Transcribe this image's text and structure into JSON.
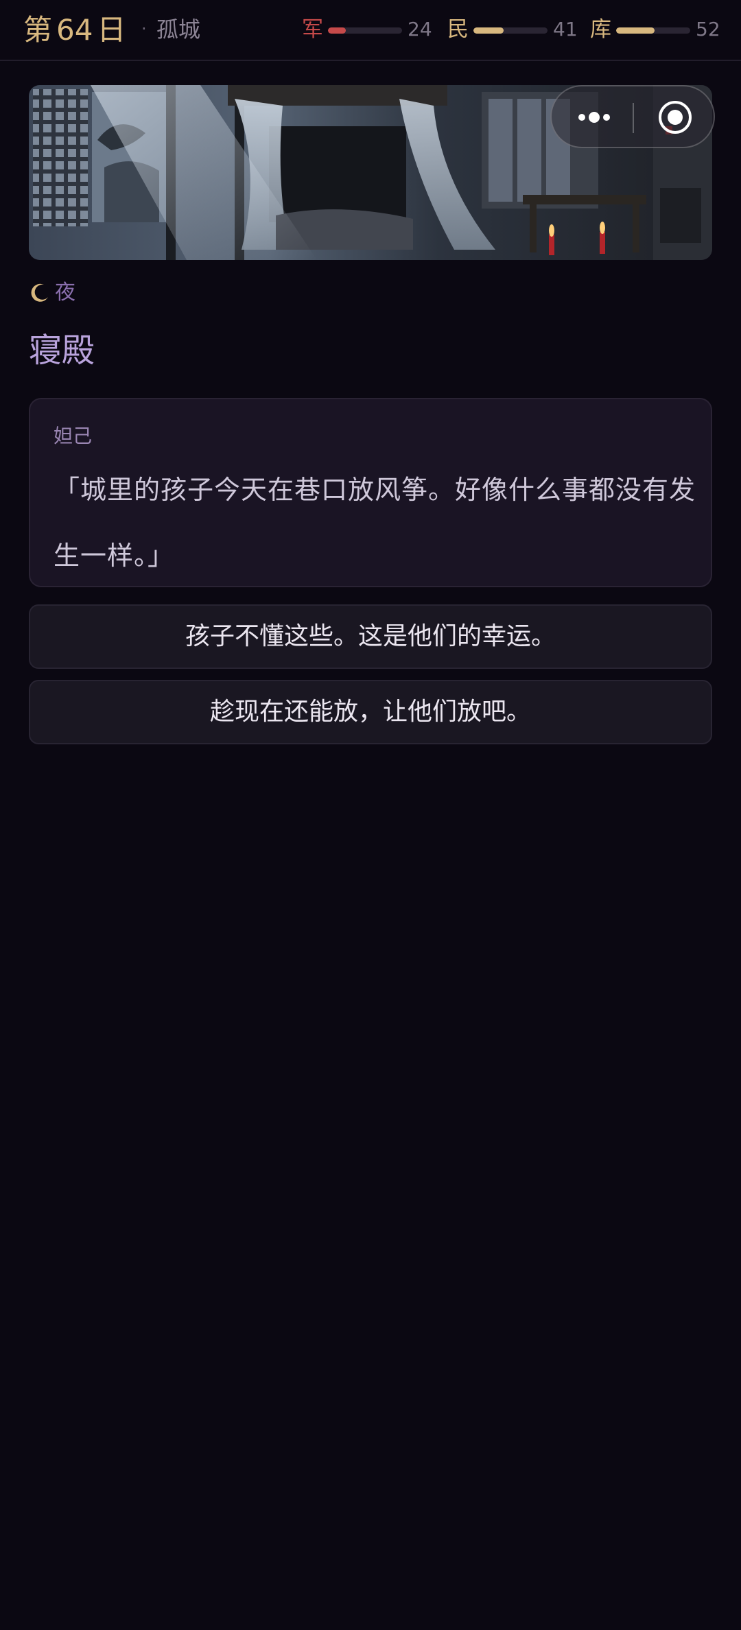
{
  "header": {
    "day_prefix": "第",
    "day_number": "64",
    "day_suffix": "日",
    "separator": "·",
    "location_name": "孤城",
    "stats": [
      {
        "label": "军",
        "value": "24",
        "fill": 0.24,
        "color": "#c64a4a"
      },
      {
        "label": "民",
        "value": "41",
        "fill": 0.41,
        "color": "#d8b87f"
      },
      {
        "label": "库",
        "value": "52",
        "fill": 0.52,
        "color": "#d8b87f"
      }
    ]
  },
  "scene": {
    "image": "palace-bedchamber-ink-painting"
  },
  "capsule": {
    "more_icon": "more-dots-icon",
    "close_icon": "record-circle-icon"
  },
  "time": {
    "icon": "crescent-moon-icon",
    "label": "夜"
  },
  "location": {
    "title": "寝殿"
  },
  "dialogue": {
    "speaker": "妲己",
    "text": "「城里的孩子今天在巷口放风筝。好像什么事都没有发生一样。」"
  },
  "choices": [
    {
      "label": "孩子不懂这些。这是他们的幸运。"
    },
    {
      "label": "趁现在还能放，让他们放吧。"
    }
  ]
}
